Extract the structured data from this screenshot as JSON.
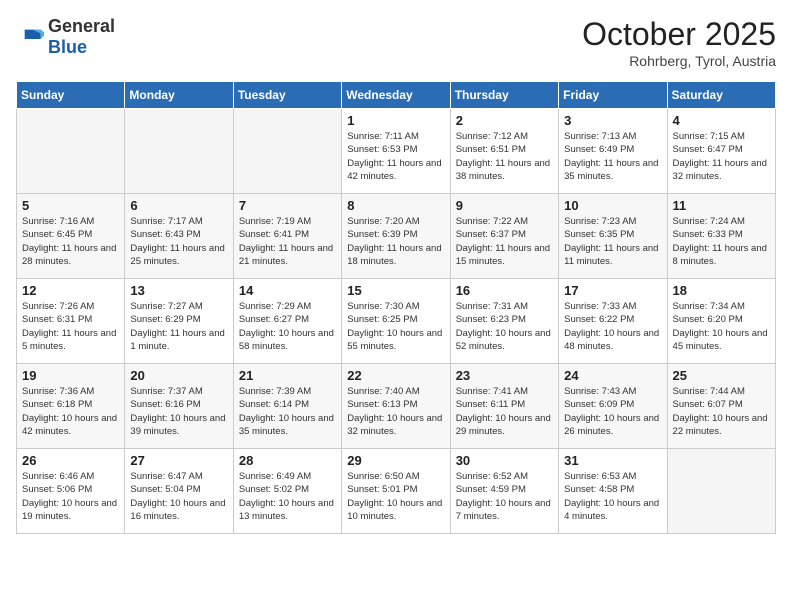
{
  "header": {
    "logo_general": "General",
    "logo_blue": "Blue",
    "month": "October 2025",
    "location": "Rohrberg, Tyrol, Austria"
  },
  "days_of_week": [
    "Sunday",
    "Monday",
    "Tuesday",
    "Wednesday",
    "Thursday",
    "Friday",
    "Saturday"
  ],
  "weeks": [
    [
      {
        "day": "",
        "empty": true
      },
      {
        "day": "",
        "empty": true
      },
      {
        "day": "",
        "empty": true
      },
      {
        "day": "1",
        "sunrise": "7:11 AM",
        "sunset": "6:53 PM",
        "daylight": "11 hours and 42 minutes."
      },
      {
        "day": "2",
        "sunrise": "7:12 AM",
        "sunset": "6:51 PM",
        "daylight": "11 hours and 38 minutes."
      },
      {
        "day": "3",
        "sunrise": "7:13 AM",
        "sunset": "6:49 PM",
        "daylight": "11 hours and 35 minutes."
      },
      {
        "day": "4",
        "sunrise": "7:15 AM",
        "sunset": "6:47 PM",
        "daylight": "11 hours and 32 minutes."
      }
    ],
    [
      {
        "day": "5",
        "sunrise": "7:16 AM",
        "sunset": "6:45 PM",
        "daylight": "11 hours and 28 minutes."
      },
      {
        "day": "6",
        "sunrise": "7:17 AM",
        "sunset": "6:43 PM",
        "daylight": "11 hours and 25 minutes."
      },
      {
        "day": "7",
        "sunrise": "7:19 AM",
        "sunset": "6:41 PM",
        "daylight": "11 hours and 21 minutes."
      },
      {
        "day": "8",
        "sunrise": "7:20 AM",
        "sunset": "6:39 PM",
        "daylight": "11 hours and 18 minutes."
      },
      {
        "day": "9",
        "sunrise": "7:22 AM",
        "sunset": "6:37 PM",
        "daylight": "11 hours and 15 minutes."
      },
      {
        "day": "10",
        "sunrise": "7:23 AM",
        "sunset": "6:35 PM",
        "daylight": "11 hours and 11 minutes."
      },
      {
        "day": "11",
        "sunrise": "7:24 AM",
        "sunset": "6:33 PM",
        "daylight": "11 hours and 8 minutes."
      }
    ],
    [
      {
        "day": "12",
        "sunrise": "7:26 AM",
        "sunset": "6:31 PM",
        "daylight": "11 hours and 5 minutes."
      },
      {
        "day": "13",
        "sunrise": "7:27 AM",
        "sunset": "6:29 PM",
        "daylight": "11 hours and 1 minute."
      },
      {
        "day": "14",
        "sunrise": "7:29 AM",
        "sunset": "6:27 PM",
        "daylight": "10 hours and 58 minutes."
      },
      {
        "day": "15",
        "sunrise": "7:30 AM",
        "sunset": "6:25 PM",
        "daylight": "10 hours and 55 minutes."
      },
      {
        "day": "16",
        "sunrise": "7:31 AM",
        "sunset": "6:23 PM",
        "daylight": "10 hours and 52 minutes."
      },
      {
        "day": "17",
        "sunrise": "7:33 AM",
        "sunset": "6:22 PM",
        "daylight": "10 hours and 48 minutes."
      },
      {
        "day": "18",
        "sunrise": "7:34 AM",
        "sunset": "6:20 PM",
        "daylight": "10 hours and 45 minutes."
      }
    ],
    [
      {
        "day": "19",
        "sunrise": "7:36 AM",
        "sunset": "6:18 PM",
        "daylight": "10 hours and 42 minutes."
      },
      {
        "day": "20",
        "sunrise": "7:37 AM",
        "sunset": "6:16 PM",
        "daylight": "10 hours and 39 minutes."
      },
      {
        "day": "21",
        "sunrise": "7:39 AM",
        "sunset": "6:14 PM",
        "daylight": "10 hours and 35 minutes."
      },
      {
        "day": "22",
        "sunrise": "7:40 AM",
        "sunset": "6:13 PM",
        "daylight": "10 hours and 32 minutes."
      },
      {
        "day": "23",
        "sunrise": "7:41 AM",
        "sunset": "6:11 PM",
        "daylight": "10 hours and 29 minutes."
      },
      {
        "day": "24",
        "sunrise": "7:43 AM",
        "sunset": "6:09 PM",
        "daylight": "10 hours and 26 minutes."
      },
      {
        "day": "25",
        "sunrise": "7:44 AM",
        "sunset": "6:07 PM",
        "daylight": "10 hours and 22 minutes."
      }
    ],
    [
      {
        "day": "26",
        "sunrise": "6:46 AM",
        "sunset": "5:06 PM",
        "daylight": "10 hours and 19 minutes."
      },
      {
        "day": "27",
        "sunrise": "6:47 AM",
        "sunset": "5:04 PM",
        "daylight": "10 hours and 16 minutes."
      },
      {
        "day": "28",
        "sunrise": "6:49 AM",
        "sunset": "5:02 PM",
        "daylight": "10 hours and 13 minutes."
      },
      {
        "day": "29",
        "sunrise": "6:50 AM",
        "sunset": "5:01 PM",
        "daylight": "10 hours and 10 minutes."
      },
      {
        "day": "30",
        "sunrise": "6:52 AM",
        "sunset": "4:59 PM",
        "daylight": "10 hours and 7 minutes."
      },
      {
        "day": "31",
        "sunrise": "6:53 AM",
        "sunset": "4:58 PM",
        "daylight": "10 hours and 4 minutes."
      },
      {
        "day": "",
        "empty": true
      }
    ]
  ]
}
